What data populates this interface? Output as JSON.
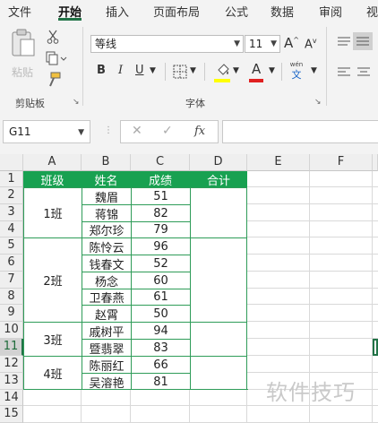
{
  "menu": {
    "tabs": [
      "文件",
      "开始",
      "插入",
      "页面布局",
      "公式",
      "数据",
      "审阅",
      "视"
    ],
    "active_tab": "开始"
  },
  "ribbon": {
    "clipboard": {
      "paste_label": "粘贴",
      "group_label": "剪贴板"
    },
    "font": {
      "font_name": "等线",
      "font_size": "11",
      "bold": "B",
      "italic": "I",
      "underline": "U",
      "grow": "A",
      "shrink": "A",
      "fill_color": "#ffff00",
      "font_color": "#e02020",
      "font_color_letter": "A",
      "phonetic_top": "wén",
      "phonetic_bottom": "文",
      "group_label": "字体"
    }
  },
  "formula_bar": {
    "name_box": "G11",
    "fx": "fx",
    "formula": ""
  },
  "grid": {
    "columns": [
      "A",
      "B",
      "C",
      "D",
      "E",
      "F"
    ],
    "rows": [
      "1",
      "2",
      "3",
      "4",
      "5",
      "6",
      "7",
      "8",
      "9",
      "10",
      "11",
      "12",
      "13",
      "14",
      "15"
    ],
    "selected_row": "11",
    "headers": {
      "class": "班级",
      "name": "姓名",
      "score": "成绩",
      "total": "合计"
    },
    "students": [
      {
        "name": "魏眉",
        "score": "51"
      },
      {
        "name": "蒋锦",
        "score": "82"
      },
      {
        "name": "郑尔珍",
        "score": "79"
      },
      {
        "name": "陈怜云",
        "score": "96"
      },
      {
        "name": "钱春文",
        "score": "52"
      },
      {
        "name": "杨念",
        "score": "60"
      },
      {
        "name": "卫春燕",
        "score": "61"
      },
      {
        "name": "赵霄",
        "score": "50"
      },
      {
        "name": "戚树平",
        "score": "94"
      },
      {
        "name": "暨翡翠",
        "score": "83"
      },
      {
        "name": "陈丽红",
        "score": "66"
      },
      {
        "name": "吴溶艳",
        "score": "81"
      }
    ],
    "classes": [
      "1班",
      "2班",
      "3班",
      "4班"
    ]
  },
  "watermark": "软件技巧",
  "colors": {
    "accent": "#217346",
    "header_fill": "#18a151",
    "border": "#2e9c58"
  }
}
